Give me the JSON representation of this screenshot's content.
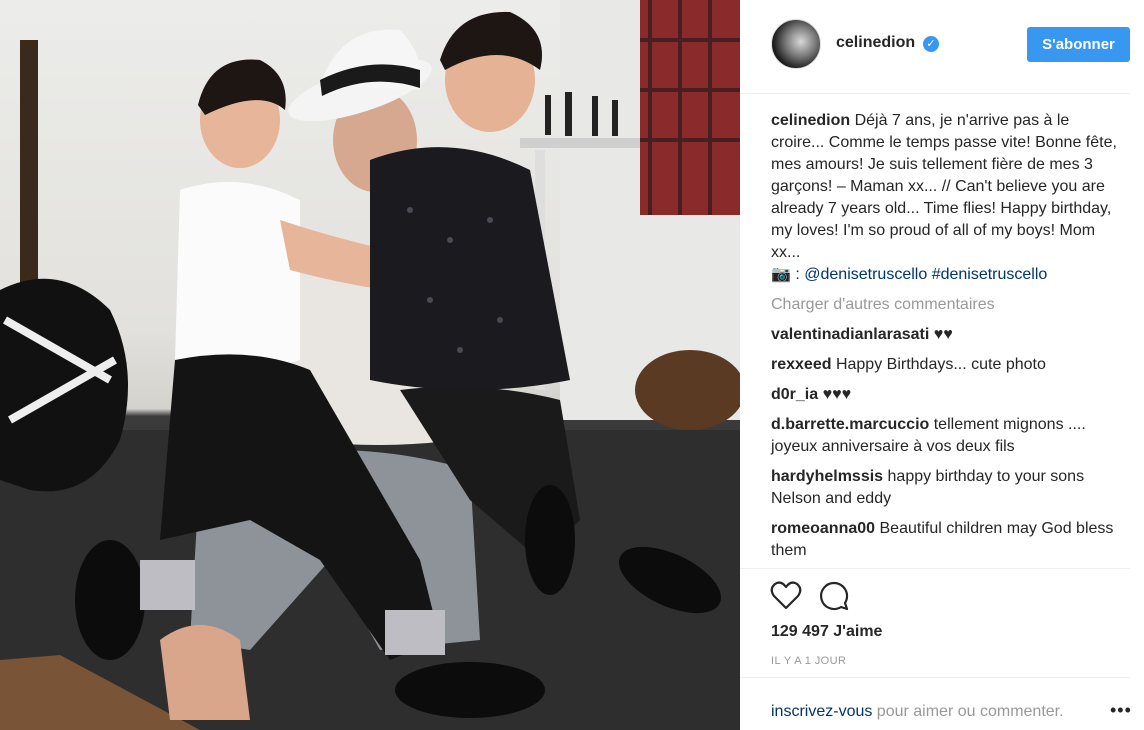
{
  "post": {
    "username": "celinedion",
    "follow_label": "S'abonner",
    "verified_mark": "✓"
  },
  "caption": {
    "author": "celinedion",
    "text": "Déjà 7 ans, je n'arrive pas à le croire... Comme le temps passe vite! Bonne fête, mes amours! Je suis tellement fière de mes 3 garçons! – Maman xx... // Can't believe you are already 7 years old... Time flies! Happy birthday, my loves! I'm so proud of all of my boys! Mom xx...",
    "credit_prefix": "📷 :",
    "mention": "@denisetruscello",
    "hashtag": "#denisetruscello"
  },
  "load_more": "Charger d'autres commentaires",
  "comments": [
    {
      "author": "valentinadianlarasati",
      "text": "♥♥"
    },
    {
      "author": "rexxeed",
      "text": "Happy Birthdays... cute photo"
    },
    {
      "author": "d0r_ia",
      "text": "♥♥♥"
    },
    {
      "author": "d.barrette.marcuccio",
      "text": "tellement mignons .... joyeux anniversaire à vos deux fils"
    },
    {
      "author": "hardyhelmssis",
      "text": "happy birthday to your sons Nelson and eddy"
    },
    {
      "author": "romeoanna00",
      "text": "Beautiful children may God bless them"
    }
  ],
  "likes": "129 497 J'aime",
  "timestamp": "IL Y A 1 JOUR",
  "footer": {
    "signup_link": "inscrivez-vous",
    "signup_text": " pour aimer ou commenter.",
    "more": "•••"
  },
  "icons": {
    "heart": "heart-icon",
    "comment": "comment-bubble-icon",
    "verified": "verified-badge-icon",
    "more": "more-options-icon"
  },
  "colors": {
    "accent": "#3897f0",
    "link": "#003569",
    "muted": "#999999"
  }
}
